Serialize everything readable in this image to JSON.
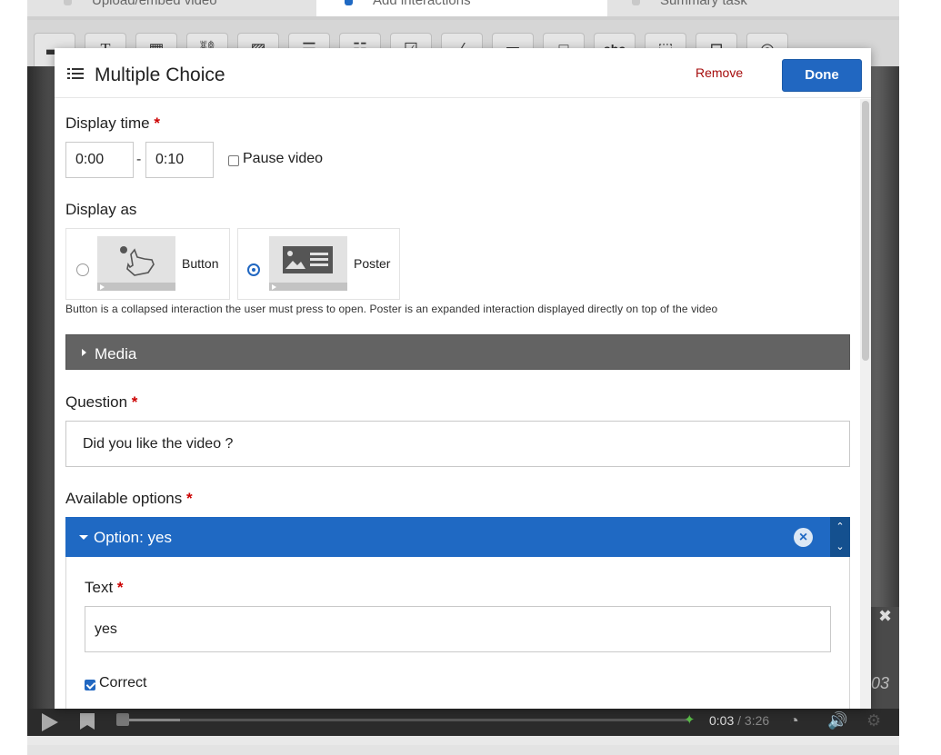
{
  "tabs": [
    {
      "label": "Upload/embed video",
      "active": false
    },
    {
      "label": "Add interactions",
      "active": true
    },
    {
      "label": "Summary task",
      "active": false
    }
  ],
  "toolbar": {
    "tools": [
      "label-icon",
      "text-icon",
      "table-icon",
      "link-icon",
      "image-icon",
      "statements-icon",
      "single-choice-icon",
      "multiple-choice-icon",
      "true-false-icon",
      "fill-blanks-icon",
      "drag-drop-icon",
      "mark-words-icon",
      "drag-text-icon",
      "navigation-hotspot-icon",
      "crosshair-icon"
    ],
    "text_tool_glyph": "T",
    "mark_words_glyph": "abc"
  },
  "dialog": {
    "icon": "list-icon",
    "title": "Multiple Choice",
    "remove_label": "Remove",
    "done_label": "Done",
    "display_time": {
      "label": "Display time",
      "required_mark": "*",
      "start": "0:00",
      "separator": "-",
      "end": "0:10",
      "pause_label": "Pause video",
      "pause_checked": false
    },
    "display_as": {
      "label": "Display as",
      "options": [
        {
          "label": "Button",
          "selected": false,
          "icon": "hand-pointer-icon"
        },
        {
          "label": "Poster",
          "selected": true,
          "icon": "poster-image-icon"
        }
      ],
      "help": "Button is a collapsed interaction the user must press to open. Poster is an expanded interaction displayed directly on top of the video"
    },
    "media": {
      "label": "Media"
    },
    "question": {
      "label": "Question",
      "required_mark": "*",
      "value": "Did you like the video ?"
    },
    "available_options": {
      "label": "Available options",
      "required_mark": "*",
      "option": {
        "header": "Option: yes",
        "remove_glyph": "×",
        "up_glyph": "⌃",
        "down_glyph": "⌄",
        "text_label": "Text",
        "required_mark": "*",
        "text_value": "yes",
        "correct_label": "Correct",
        "correct_checked": true
      }
    }
  },
  "video": {
    "current_time": "0:03",
    "separator": "/",
    "duration": "3:26",
    "overlay_time": "03",
    "overlay_close": "✖"
  },
  "colors": {
    "accent": "#2167c1",
    "remove": "#a50b0b",
    "media_bar": "#636363",
    "required": "#cc0000"
  }
}
